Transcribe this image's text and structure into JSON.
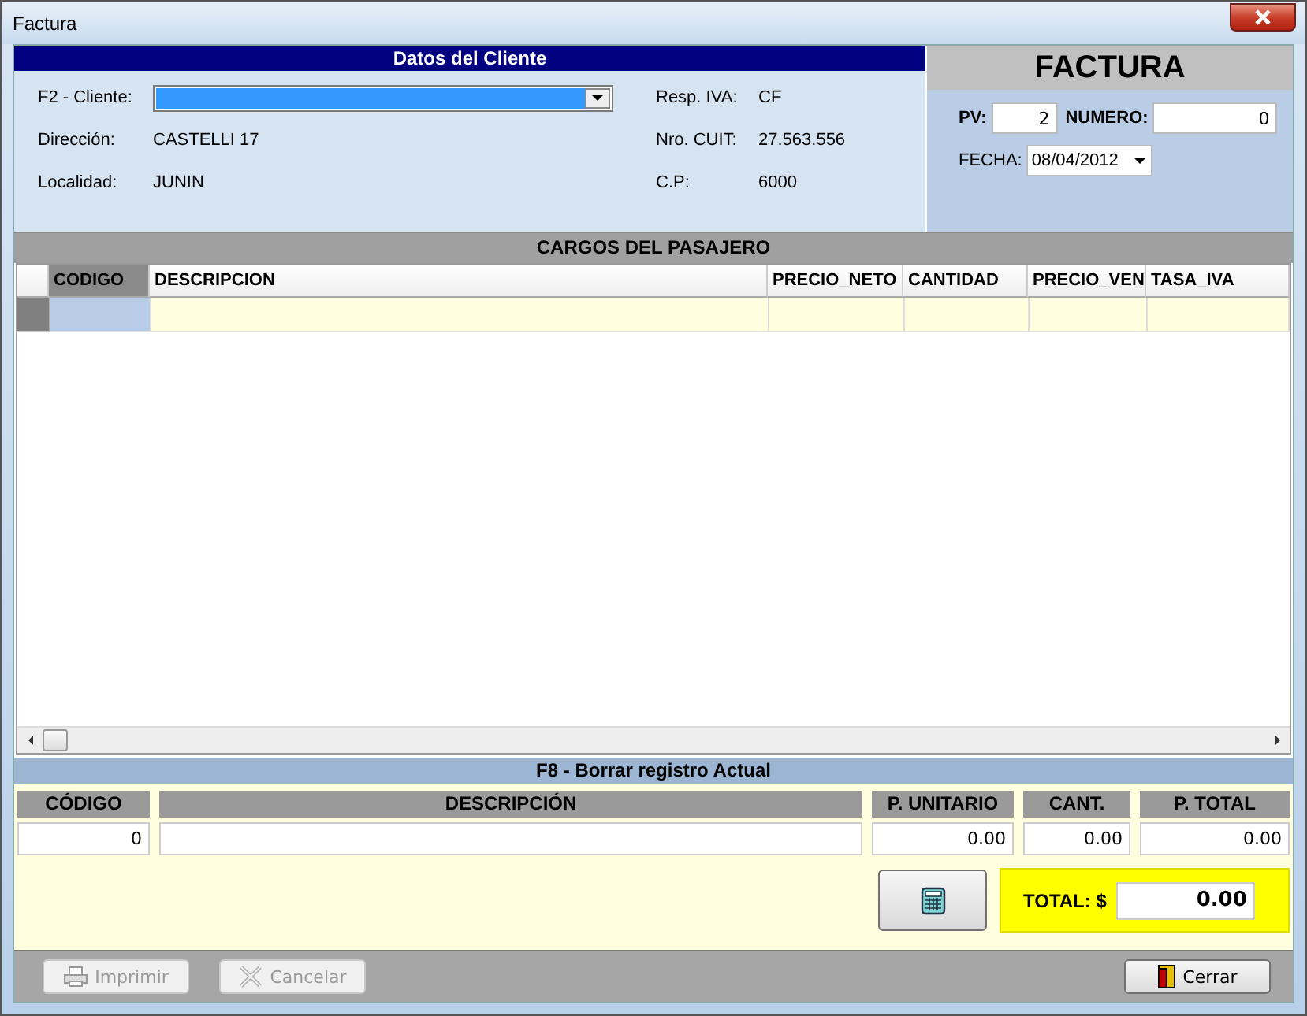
{
  "window": {
    "title": "Factura"
  },
  "client": {
    "title": "Datos del Cliente",
    "left": [
      {
        "label": "F2 -  Cliente:",
        "kind": "combo",
        "focused": true
      },
      {
        "label": "Dirección:",
        "kind": "text",
        "value": "CASTELLI 17"
      },
      {
        "label": "Localidad:",
        "kind": "text",
        "value": "JUNIN"
      }
    ],
    "right": [
      {
        "label": "Resp. IVA:",
        "value": "CF"
      },
      {
        "label": "Nro. CUIT:",
        "value": "27.563.556"
      },
      {
        "label": "C.P:",
        "value": "6000"
      }
    ]
  },
  "invoice": {
    "title": "FACTURA",
    "pv_label": "PV:",
    "pv": "2",
    "numero_label": "NUMERO:",
    "numero": "0",
    "fecha_label": "FECHA:",
    "fecha": "08/04/2012"
  },
  "grid": {
    "title": "CARGOS DEL PASAJERO",
    "columns": [
      {
        "label": "CODIGO",
        "selected": true
      },
      {
        "label": "DESCRIPCION",
        "selected": false
      },
      {
        "label": "PRECIO_NETO",
        "selected": false
      },
      {
        "label": "CANTIDAD",
        "selected": false
      },
      {
        "label": "PRECIO_VEN",
        "selected": false
      },
      {
        "label": "TASA_IVA",
        "selected": false
      }
    ],
    "rows": [
      {
        "current": true,
        "cells": [
          {
            "selected": true
          },
          {
            "selected": false
          },
          {
            "selected": false
          },
          {
            "selected": false
          },
          {
            "selected": false
          },
          {
            "selected": false
          }
        ]
      }
    ]
  },
  "entry": {
    "title": "F8 - Borrar registro Actual",
    "fields": [
      {
        "label": "CÓDIGO",
        "value": "0"
      },
      {
        "label": "DESCRIPCIÓN"
      },
      {
        "label": "P. UNITARIO",
        "value": "0.00"
      },
      {
        "label": "CANT.",
        "value": "0.00"
      },
      {
        "label": "P. TOTAL",
        "value": "0.00"
      }
    ]
  },
  "total": {
    "label": "TOTAL: $",
    "value": "0.00"
  },
  "buttons": [
    {
      "label": "Imprimir",
      "disabled": true
    },
    {
      "label": "Cancelar",
      "disabled": true
    },
    {
      "label": "Cerrar",
      "disabled": false
    }
  ]
}
